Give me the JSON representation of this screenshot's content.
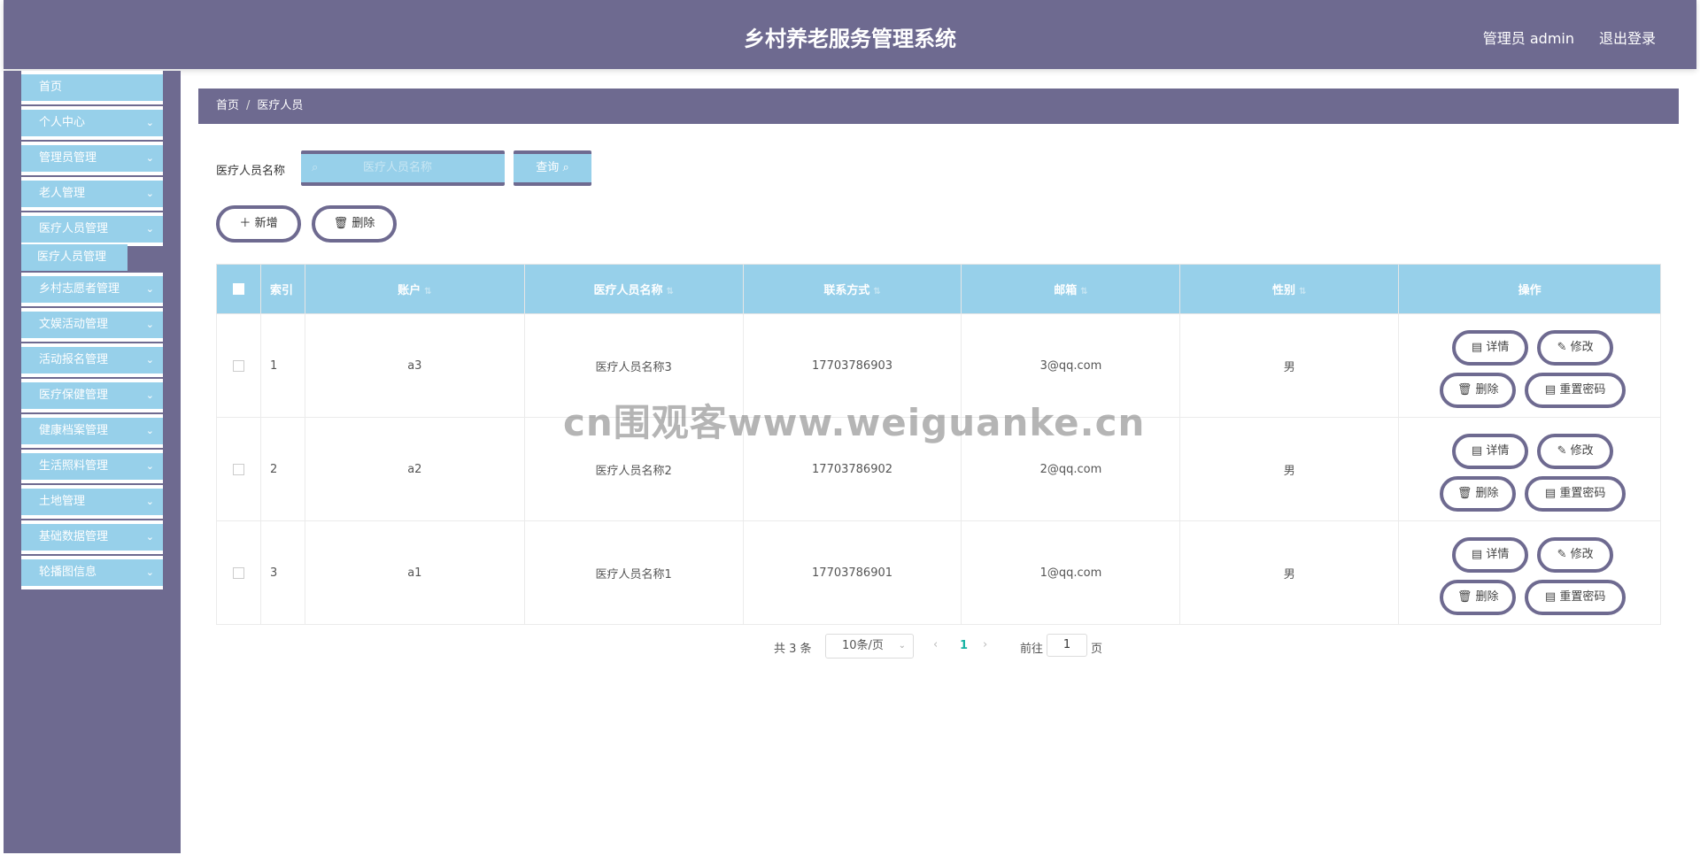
{
  "header": {
    "title": "乡村养老服务管理系统",
    "user": "管理员 admin",
    "logout": "退出登录"
  },
  "sidebar": {
    "items": [
      {
        "label": "首页",
        "expandable": false
      },
      {
        "label": "个人中心",
        "expandable": true
      },
      {
        "label": "管理员管理",
        "expandable": true
      },
      {
        "label": "老人管理",
        "expandable": true
      },
      {
        "label": "医疗人员管理",
        "expandable": true
      },
      {
        "label": "乡村志愿者管理",
        "expandable": true
      },
      {
        "label": "文娱活动管理",
        "expandable": true
      },
      {
        "label": "活动报名管理",
        "expandable": true
      },
      {
        "label": "医疗保健管理",
        "expandable": true
      },
      {
        "label": "健康档案管理",
        "expandable": true
      },
      {
        "label": "生活照料管理",
        "expandable": true
      },
      {
        "label": "土地管理",
        "expandable": true
      },
      {
        "label": "基础数据管理",
        "expandable": true
      },
      {
        "label": "轮播图信息",
        "expandable": true
      }
    ],
    "active_submenu": "医疗人员管理"
  },
  "breadcrumb": {
    "home": "首页",
    "separator": "/",
    "current": "医疗人员"
  },
  "search": {
    "label": "医疗人员名称",
    "placeholder": "医疗人员名称",
    "query_button": "查询"
  },
  "actions": {
    "add": "新增",
    "delete": "删除"
  },
  "table": {
    "headers": [
      "索引",
      "账户",
      "医疗人员名称",
      "联系方式",
      "邮箱",
      "性别",
      "操作"
    ],
    "rows": [
      {
        "index": "1",
        "account": "a3",
        "name": "医疗人员名称3",
        "phone": "17703786903",
        "email": "3@qq.com",
        "gender": "男"
      },
      {
        "index": "2",
        "account": "a2",
        "name": "医疗人员名称2",
        "phone": "17703786902",
        "email": "2@qq.com",
        "gender": "男"
      },
      {
        "index": "3",
        "account": "a1",
        "name": "医疗人员名称1",
        "phone": "17703786901",
        "email": "1@qq.com",
        "gender": "男"
      }
    ],
    "row_actions": {
      "detail": "详情",
      "edit": "修改",
      "delete": "删除",
      "reset_password": "重置密码"
    }
  },
  "pagination": {
    "total": "共 3 条",
    "page_size": "10条/页",
    "current_page": "1",
    "goto_label": "前往",
    "goto_value": "1",
    "page_suffix": "页"
  },
  "watermark": "cn围观客www.weiguanke.cn",
  "colors": {
    "header_bg": "#6e6a90",
    "menu_bg": "#97d0ea",
    "table_header_bg": "#97d0ea",
    "active_page": "#17b3a3"
  }
}
